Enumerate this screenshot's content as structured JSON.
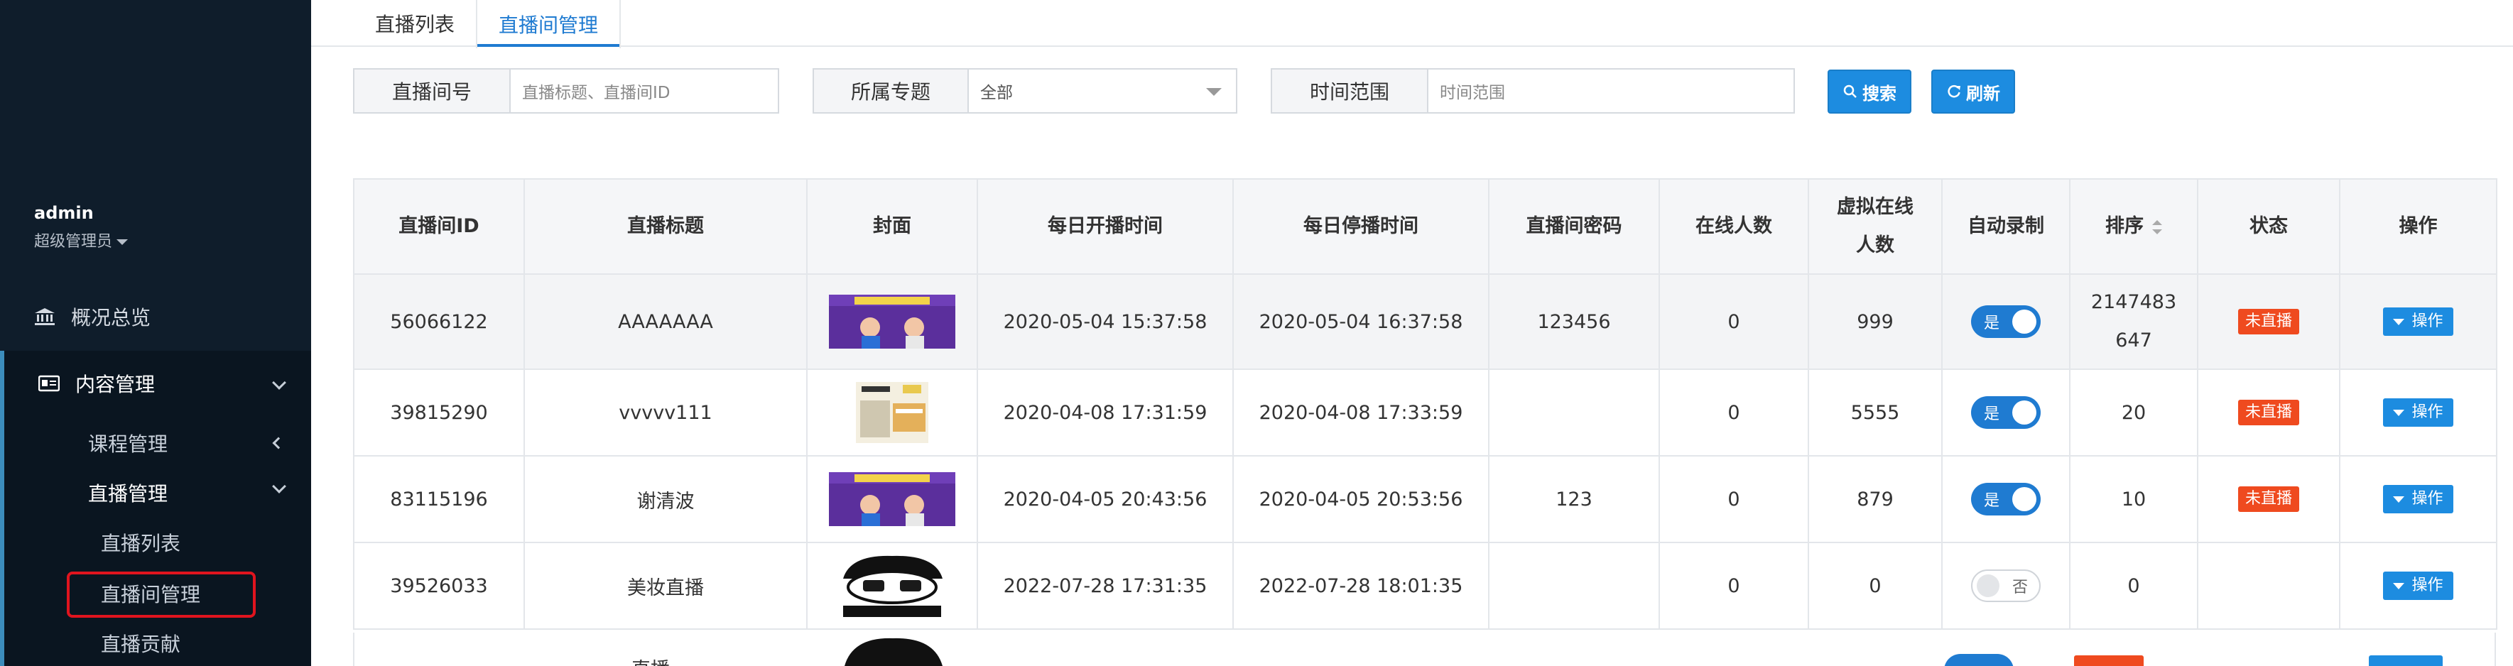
{
  "sidebar": {
    "user_name": "admin",
    "user_role": "超级管理员",
    "overview": "概况总览",
    "content_mgmt": "内容管理",
    "course_mgmt": "课程管理",
    "live_mgmt": "直播管理",
    "live_list": "直播列表",
    "live_room_mgmt": "直播间管理",
    "live_contrib": "直播贡献"
  },
  "tabs": [
    "直播列表",
    "直播间管理"
  ],
  "filters": {
    "room_no_label": "直播间号",
    "room_no_placeholder": "直播标题、直播间ID",
    "topic_label": "所属专题",
    "topic_value": "全部",
    "time_label": "时间范围",
    "time_placeholder": "时间范围"
  },
  "buttons": {
    "search": "搜索",
    "refresh": "刷新"
  },
  "table": {
    "headers": {
      "id": "直播间ID",
      "title": "直播标题",
      "cover": "封面",
      "start": "每日开播时间",
      "stop": "每日停播时间",
      "password": "直播间密码",
      "online": "在线人数",
      "virtual_1": "虚拟在线",
      "virtual_2": "人数",
      "auto_record": "自动录制",
      "sort": "排序",
      "status": "状态",
      "ops": "操作"
    },
    "rows": [
      {
        "id": "56066122",
        "title": "AAAAAAA",
        "start": "2020-05-04 15:37:58",
        "stop": "2020-05-04 16:37:58",
        "password": "123456",
        "online": "0",
        "virtual": "999",
        "record": "是",
        "sort_1": "2147483",
        "sort_2": "647",
        "status": "未直播",
        "op": "操作"
      },
      {
        "id": "39815290",
        "title": "vvvvv111",
        "start": "2020-04-08 17:31:59",
        "stop": "2020-04-08 17:33:59",
        "password": "",
        "online": "0",
        "virtual": "5555",
        "record": "是",
        "sort_1": "20",
        "sort_2": "",
        "status": "未直播",
        "op": "操作"
      },
      {
        "id": "83115196",
        "title": "谢清波",
        "start": "2020-04-05 20:43:56",
        "stop": "2020-04-05 20:53:56",
        "password": "123",
        "online": "0",
        "virtual": "879",
        "record": "是",
        "sort_1": "10",
        "sort_2": "",
        "status": "未直播",
        "op": "操作"
      },
      {
        "id": "39526033",
        "title": "美妆直播",
        "start": "2022-07-28 17:31:35",
        "stop": "2022-07-28 18:01:35",
        "password": "",
        "online": "0",
        "virtual": "0",
        "record": "否",
        "sort_1": "0",
        "sort_2": "",
        "status": "",
        "op": "操作"
      }
    ],
    "partial_title": "直播"
  },
  "colors": {
    "sidebar_bg": "#0f1d2b",
    "accent": "#1f7bd1",
    "status_red": "#ef4a1f",
    "highlight_border": "#e0141e"
  }
}
